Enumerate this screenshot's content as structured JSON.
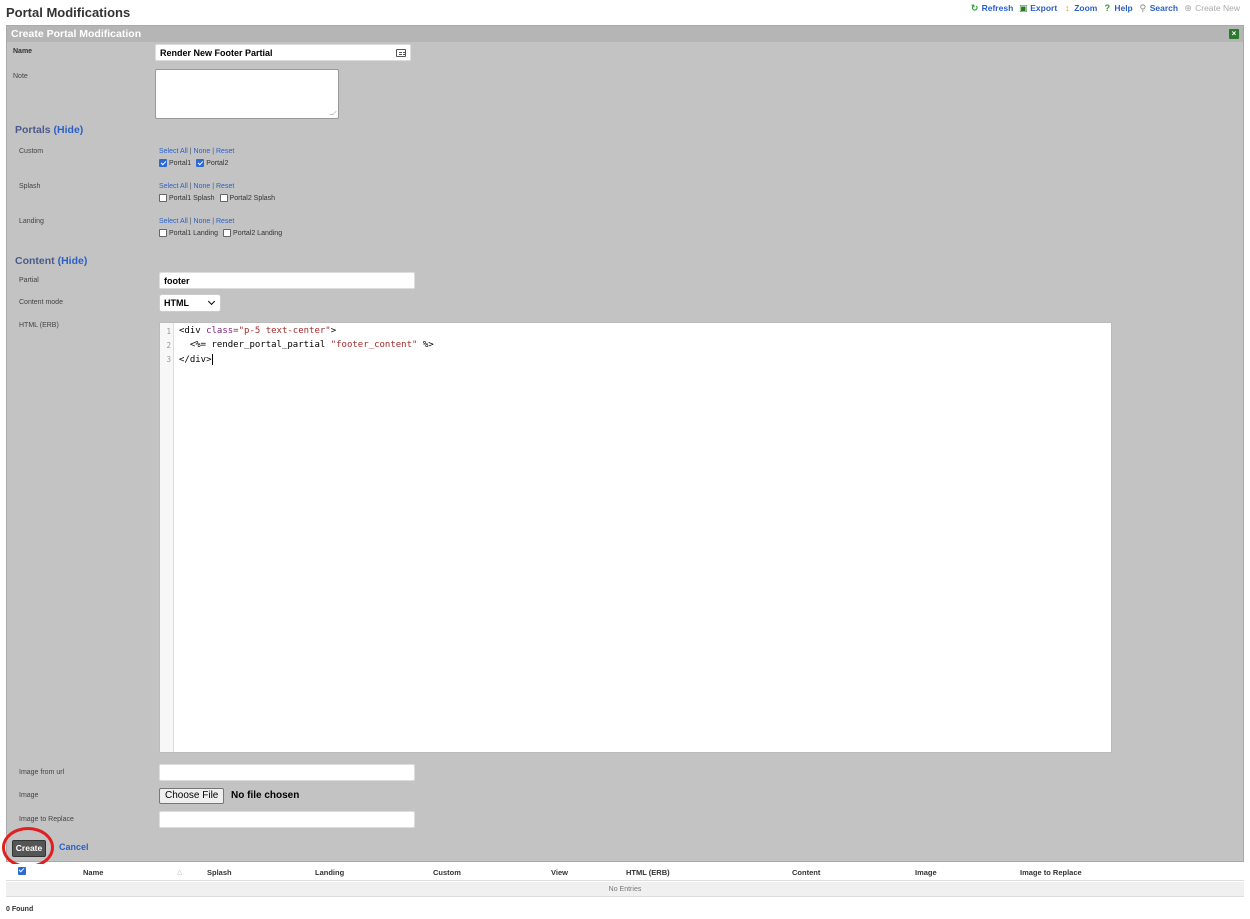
{
  "page": {
    "title": "Portal Modifications"
  },
  "toolbar": {
    "refresh": "Refresh",
    "export": "Export",
    "zoom": "Zoom",
    "help": "Help",
    "search": "Search",
    "create_new": "Create New"
  },
  "panel": {
    "title": "Create Portal Modification"
  },
  "form": {
    "name_label": "Name",
    "name_value": "Render New Footer Partial",
    "note_label": "Note",
    "note_value": ""
  },
  "portals": {
    "title": "Portals",
    "hide": "(Hide)",
    "select_all": "Select All",
    "none": "None",
    "reset": "Reset",
    "sep": "|",
    "groups": [
      {
        "label": "Custom",
        "options": [
          {
            "label": "Portal1",
            "checked": true
          },
          {
            "label": "Portal2",
            "checked": true
          }
        ]
      },
      {
        "label": "Splash",
        "options": [
          {
            "label": "Portal1 Splash",
            "checked": false
          },
          {
            "label": "Portal2 Splash",
            "checked": false
          }
        ]
      },
      {
        "label": "Landing",
        "options": [
          {
            "label": "Portal1 Landing",
            "checked": false
          },
          {
            "label": "Portal2 Landing",
            "checked": false
          }
        ]
      }
    ]
  },
  "content": {
    "title": "Content",
    "hide": "(Hide)",
    "partial_label": "Partial",
    "partial_value": "footer",
    "mode_label": "Content mode",
    "mode_value": "HTML",
    "html_label": "HTML (ERB)",
    "code_lines": [
      {
        "num": "1",
        "parts": [
          [
            "tag",
            "<div "
          ],
          [
            "attr",
            "class="
          ],
          [
            "str",
            "\"p-5 text-center\""
          ],
          [
            "tag",
            ">"
          ]
        ]
      },
      {
        "num": "2",
        "parts": [
          [
            "erb",
            "  <%= render_portal_partial "
          ],
          [
            "str",
            "\"footer_content\""
          ],
          [
            "erb",
            " %>"
          ]
        ]
      },
      {
        "num": "3",
        "parts": [
          [
            "tag",
            "</div>"
          ]
        ]
      }
    ],
    "image_url_label": "Image from url",
    "image_url_value": "",
    "image_label": "Image",
    "choose_file": "Choose File",
    "no_file": "No file chosen",
    "image_replace_label": "Image to Replace",
    "image_replace_value": ""
  },
  "actions": {
    "create": "Create",
    "cancel": "Cancel"
  },
  "table": {
    "columns": [
      "Name",
      "Splash",
      "Landing",
      "Custom",
      "View",
      "HTML (ERB)",
      "Content",
      "Image",
      "Image to Replace"
    ],
    "empty_text": "No Entries",
    "found_text": "0 Found"
  }
}
